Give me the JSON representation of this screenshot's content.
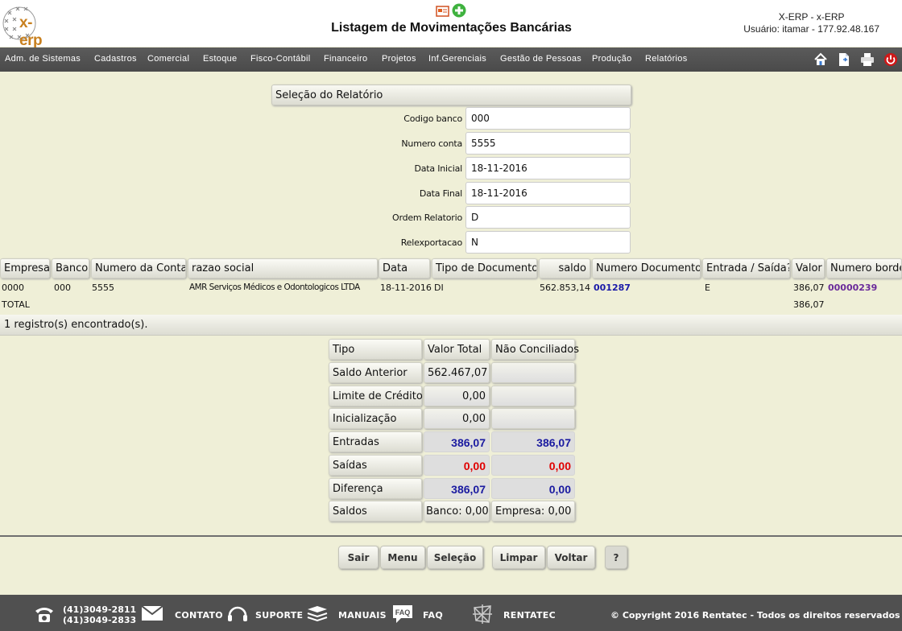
{
  "header": {
    "logo_text": "x-erp",
    "title": "Listagem de Movimentações Bancárias",
    "system": "X-ERP - x-ERP",
    "user": "Usuário: itamar - 177.92.48.167"
  },
  "menu": {
    "items": [
      "Adm. de Sistemas",
      "Cadastros",
      "Comercial",
      "Estoque",
      "Fisco-Contábil",
      "Financeiro",
      "Projetos",
      "Inf.Gerenciais",
      "Gestão de Pessoas",
      "Produção",
      "Relatórios"
    ]
  },
  "selection": {
    "title": "Seleção do Relatório",
    "fields": [
      {
        "label": "Codigo banco",
        "value": "000"
      },
      {
        "label": "Numero conta",
        "value": "5555"
      },
      {
        "label": "Data Inicial",
        "value": "18-11-2016"
      },
      {
        "label": "Data Final",
        "value": "18-11-2016"
      },
      {
        "label": "Ordem Relatorio",
        "value": "D"
      },
      {
        "label": "Relexportacao",
        "value": "N"
      }
    ]
  },
  "table": {
    "columns": [
      "Empresa",
      "Banco",
      "Numero da Conta",
      "razao  social",
      "Data",
      "Tipo de Documento",
      "saldo",
      "Numero Documento",
      "Entrada / Saída?",
      "Valor",
      "Numero borde"
    ],
    "row": {
      "empresa": "0000",
      "banco": "000",
      "conta": "5555",
      "razao": "AMR Serviços Médicos e Odontologicos LTDA",
      "data": "18-11-2016",
      "tipo": "DI",
      "saldo": "562.853,14",
      "documento": "001287",
      "es": "E",
      "valor": "386,07",
      "bordero": "00000239"
    },
    "total_label": "TOTAL",
    "total_valor": "386,07",
    "records": "1 registro(s) encontrado(s)."
  },
  "summary": {
    "headers": [
      "Tipo",
      "Valor Total",
      "Não Conciliados"
    ],
    "rows": [
      {
        "tipo": "Saldo Anterior",
        "total": "562.467,07",
        "nc": ""
      },
      {
        "tipo": "Limite de Crédito",
        "total": "0,00",
        "nc": ""
      },
      {
        "tipo": "Inicialização",
        "total": "0,00",
        "nc": ""
      },
      {
        "tipo": "Entradas",
        "total": "386,07",
        "nc": "386,07"
      },
      {
        "tipo": "Saídas",
        "total": "0,00",
        "nc": "0,00"
      },
      {
        "tipo": "Diferença",
        "total": "386,07",
        "nc": "0,00"
      },
      {
        "tipo": "Saldos",
        "total": "Banco: 0,00",
        "nc": "Empresa: 0,00"
      }
    ]
  },
  "buttons": {
    "sair": "Sair",
    "menu": "Menu",
    "selecao": "Seleção",
    "limpar": "Limpar",
    "voltar": "Voltar",
    "help": "?"
  },
  "footer": {
    "phone1": "(41)3049-2811",
    "phone2": "(41)3049-2833",
    "contato": "CONTATO",
    "suporte": "SUPORTE",
    "manuais": "MANUAIS",
    "faq": "FAQ",
    "faq_icon_text": "FAQ",
    "rentatec": "RENTATEC",
    "copyright": "© Copyright 2016 Rentatec - Todos os direitos reservados"
  },
  "colors": {
    "background": "#efefd7",
    "menubar": "#505050",
    "positive": "#1a1aa0",
    "negative": "#e00000"
  }
}
